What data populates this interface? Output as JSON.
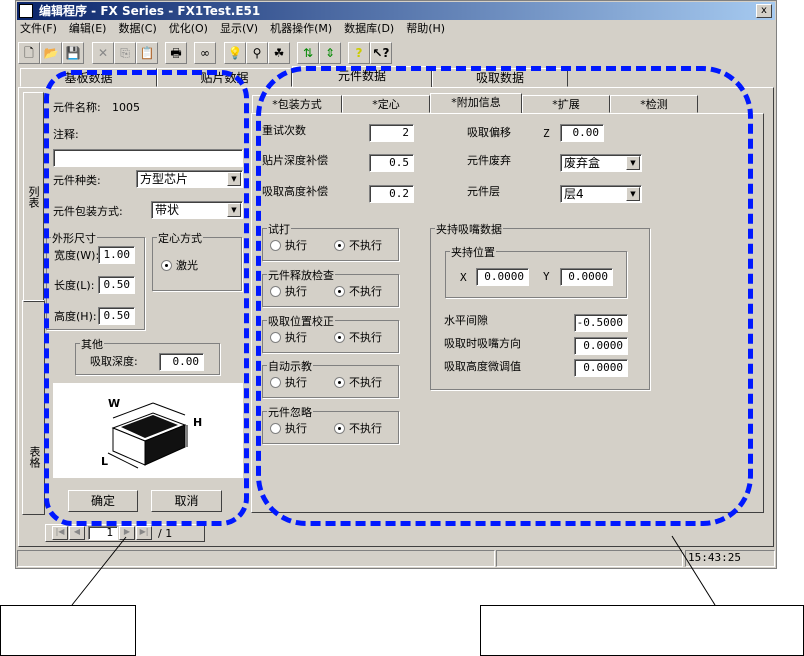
{
  "window": {
    "title": "编辑程序  - FX Series - FX1Test.E51",
    "close": "x"
  },
  "menu": [
    "文件(F)",
    "编辑(E)",
    "数据(C)",
    "优化(O)",
    "显示(V)",
    "机器操作(M)",
    "数据库(D)",
    "帮助(H)"
  ],
  "toolbar": {
    "new": "🗋",
    "open": "📂",
    "save": "💾",
    "cut": "✕",
    "copy": "⎘",
    "paste": "📋",
    "print": "🖶",
    "find": "∞",
    "light": "💡",
    "tool1": "⚲",
    "tool2": "☘",
    "tool3": "⇅",
    "tool4": "⇕",
    "help": "?",
    "whatsthis": "↖?"
  },
  "outer_tabs": [
    "基板数据",
    "贴片数据",
    "元件数据",
    "吸取数据"
  ],
  "side_tabs": [
    "列表",
    "表格"
  ],
  "left": {
    "name_label": "元件名称:",
    "name_value": "1005",
    "comment_label": "注释:",
    "comment_value": "",
    "type_label": "元件种类:",
    "type_value": "方型芯片",
    "pack_label": "元件包装方式:",
    "pack_value": "带状",
    "size_group": "外形尺寸",
    "width_label": "宽度(W):",
    "width_value": "1.00",
    "length_label": "长度(L):",
    "length_value": "0.50",
    "height_label": "高度(H):",
    "height_value": "0.50",
    "center_group": "定心方式",
    "center_option": "激光",
    "other_group": "其他",
    "depth_label": "吸取深度:",
    "depth_value": "0.00",
    "diagram": {
      "w": "W",
      "h": "H",
      "l": "L"
    },
    "ok": "确定",
    "cancel": "取消"
  },
  "pager": {
    "current": "1",
    "total": "/ 1"
  },
  "inner_tabs": [
    "*包装方式",
    "*定心",
    "*附加信息",
    "*扩展",
    "*检测"
  ],
  "info": {
    "retry_label": "重试次数",
    "retry_value": "2",
    "mount_depth_label": "贴片深度补偿",
    "mount_depth_value": "0.5",
    "pick_height_label": "吸取高度补偿",
    "pick_height_value": "0.2",
    "pick_offset_label": "吸取偏移",
    "z_label": "Z",
    "z_value": "0.00",
    "discard_label": "元件废弃",
    "discard_value": "废弃盒",
    "layer_label": "元件层",
    "layer_value": "层4",
    "groups": [
      {
        "title": "试打",
        "yes": "执行",
        "no": "不执行"
      },
      {
        "title": "元件释放检查",
        "yes": "执行",
        "no": "不执行"
      },
      {
        "title": "吸取位置校正",
        "yes": "执行",
        "no": "不执行"
      },
      {
        "title": "自动示教",
        "yes": "执行",
        "no": "不执行"
      },
      {
        "title": "元件忽略",
        "yes": "执行",
        "no": "不执行"
      }
    ],
    "nozzle_group": "夹持吸嘴数据",
    "hold_group": "夹持位置",
    "x_label": "X",
    "x_value": "0.0000",
    "y_label": "Y",
    "y_value": "0.0000",
    "gap_label": "水平间隙",
    "gap_value": "-0.5000",
    "dir_label": "吸取时吸嘴方向",
    "dir_value": "0.0000",
    "fine_label": "吸取高度微调值",
    "fine_value": "0.0000"
  },
  "status": {
    "time": "15:43:25"
  },
  "annotations": [
    "",
    ""
  ]
}
